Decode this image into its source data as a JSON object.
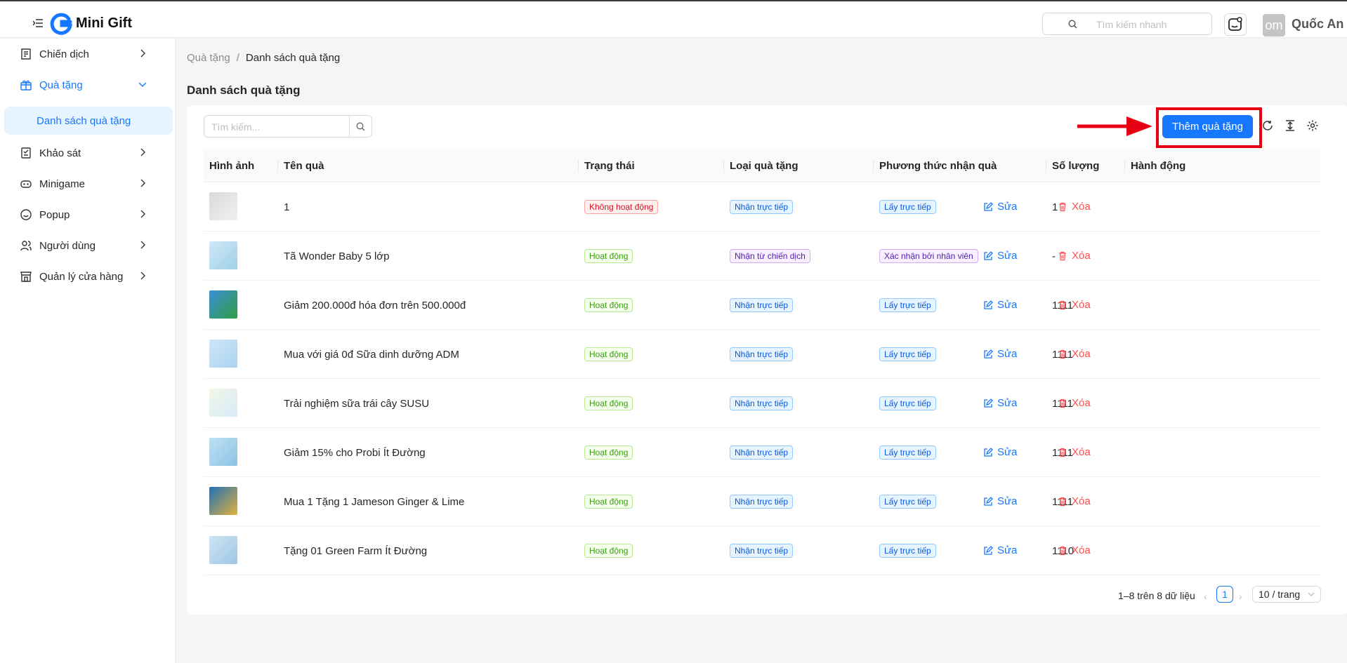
{
  "header": {
    "app_name": "Mini Gift",
    "search_placeholder": "Tìm kiếm nhanh",
    "avatar_initials": "om",
    "user_name": "Quốc An"
  },
  "sidebar": {
    "items": [
      {
        "label": "Chiến dịch",
        "icon": "campaign-icon"
      },
      {
        "label": "Quà tặng",
        "icon": "gift-icon",
        "expanded": true
      },
      {
        "label": "Khảo sát",
        "icon": "survey-icon"
      },
      {
        "label": "Minigame",
        "icon": "game-icon"
      },
      {
        "label": "Popup",
        "icon": "popup-icon"
      },
      {
        "label": "Người dùng",
        "icon": "users-icon"
      },
      {
        "label": "Quản lý cửa hàng",
        "icon": "store-icon"
      }
    ],
    "active_sub_item": "Danh sách quà tặng"
  },
  "breadcrumb": {
    "parent": "Quà tặng",
    "separator": "/",
    "current": "Danh sách quà tặng"
  },
  "page_title": "Danh sách quà tặng",
  "toolbar": {
    "search_placeholder": "Tìm kiếm...",
    "add_label": "Thêm quà tặng"
  },
  "table": {
    "columns": [
      "Hình ảnh",
      "Tên quà",
      "Trạng thái",
      "Loại quà tặng",
      "Phương thức nhận quà",
      "Số lượng",
      "Hành động"
    ],
    "edit_label": "Sửa",
    "delete_label": "Xóa",
    "rows": [
      {
        "name": "1",
        "status": "Không hoạt động",
        "status_color": "red",
        "type": "Nhận trực tiếp",
        "type_color": "blue",
        "method": "Lấy trực tiếp",
        "method_color": "blue",
        "qty": "1"
      },
      {
        "name": "Tã Wonder Baby 5 lớp",
        "status": "Hoạt động",
        "status_color": "green",
        "type": "Nhận từ chiến dịch",
        "type_color": "purple",
        "method": "Xác nhận bởi nhân viên",
        "method_color": "purple",
        "qty": "-"
      },
      {
        "name": "Giảm 200.000đ hóa đơn trên 500.000đ",
        "status": "Hoạt động",
        "status_color": "green",
        "type": "Nhận trực tiếp",
        "type_color": "blue",
        "method": "Lấy trực tiếp",
        "method_color": "blue",
        "qty": "1111"
      },
      {
        "name": "Mua với giá 0đ Sữa dinh dưỡng ADM",
        "status": "Hoạt động",
        "status_color": "green",
        "type": "Nhận trực tiếp",
        "type_color": "blue",
        "method": "Lấy trực tiếp",
        "method_color": "blue",
        "qty": "1111"
      },
      {
        "name": "Trải nghiệm sữa trái cây SUSU",
        "status": "Hoạt động",
        "status_color": "green",
        "type": "Nhận trực tiếp",
        "type_color": "blue",
        "method": "Lấy trực tiếp",
        "method_color": "blue",
        "qty": "1111"
      },
      {
        "name": "Giảm 15% cho Probi Ít Đường",
        "status": "Hoạt động",
        "status_color": "green",
        "type": "Nhận trực tiếp",
        "type_color": "blue",
        "method": "Lấy trực tiếp",
        "method_color": "blue",
        "qty": "1111"
      },
      {
        "name": "Mua 1 Tặng 1 Jameson Ginger & Lime",
        "status": "Hoạt động",
        "status_color": "green",
        "type": "Nhận trực tiếp",
        "type_color": "blue",
        "method": "Lấy trực tiếp",
        "method_color": "blue",
        "qty": "1111"
      },
      {
        "name": "Tặng 01 Green Farm Ít Đường",
        "status": "Hoạt động",
        "status_color": "green",
        "type": "Nhận trực tiếp",
        "type_color": "blue",
        "method": "Lấy trực tiếp",
        "method_color": "blue",
        "qty": "1110"
      }
    ]
  },
  "pagination": {
    "summary": "1–8 trên 8 dữ liệu",
    "current_page": "1",
    "page_size": "10 / trang"
  },
  "colors": {
    "primary": "#1677ff",
    "highlight": "#e60012"
  }
}
